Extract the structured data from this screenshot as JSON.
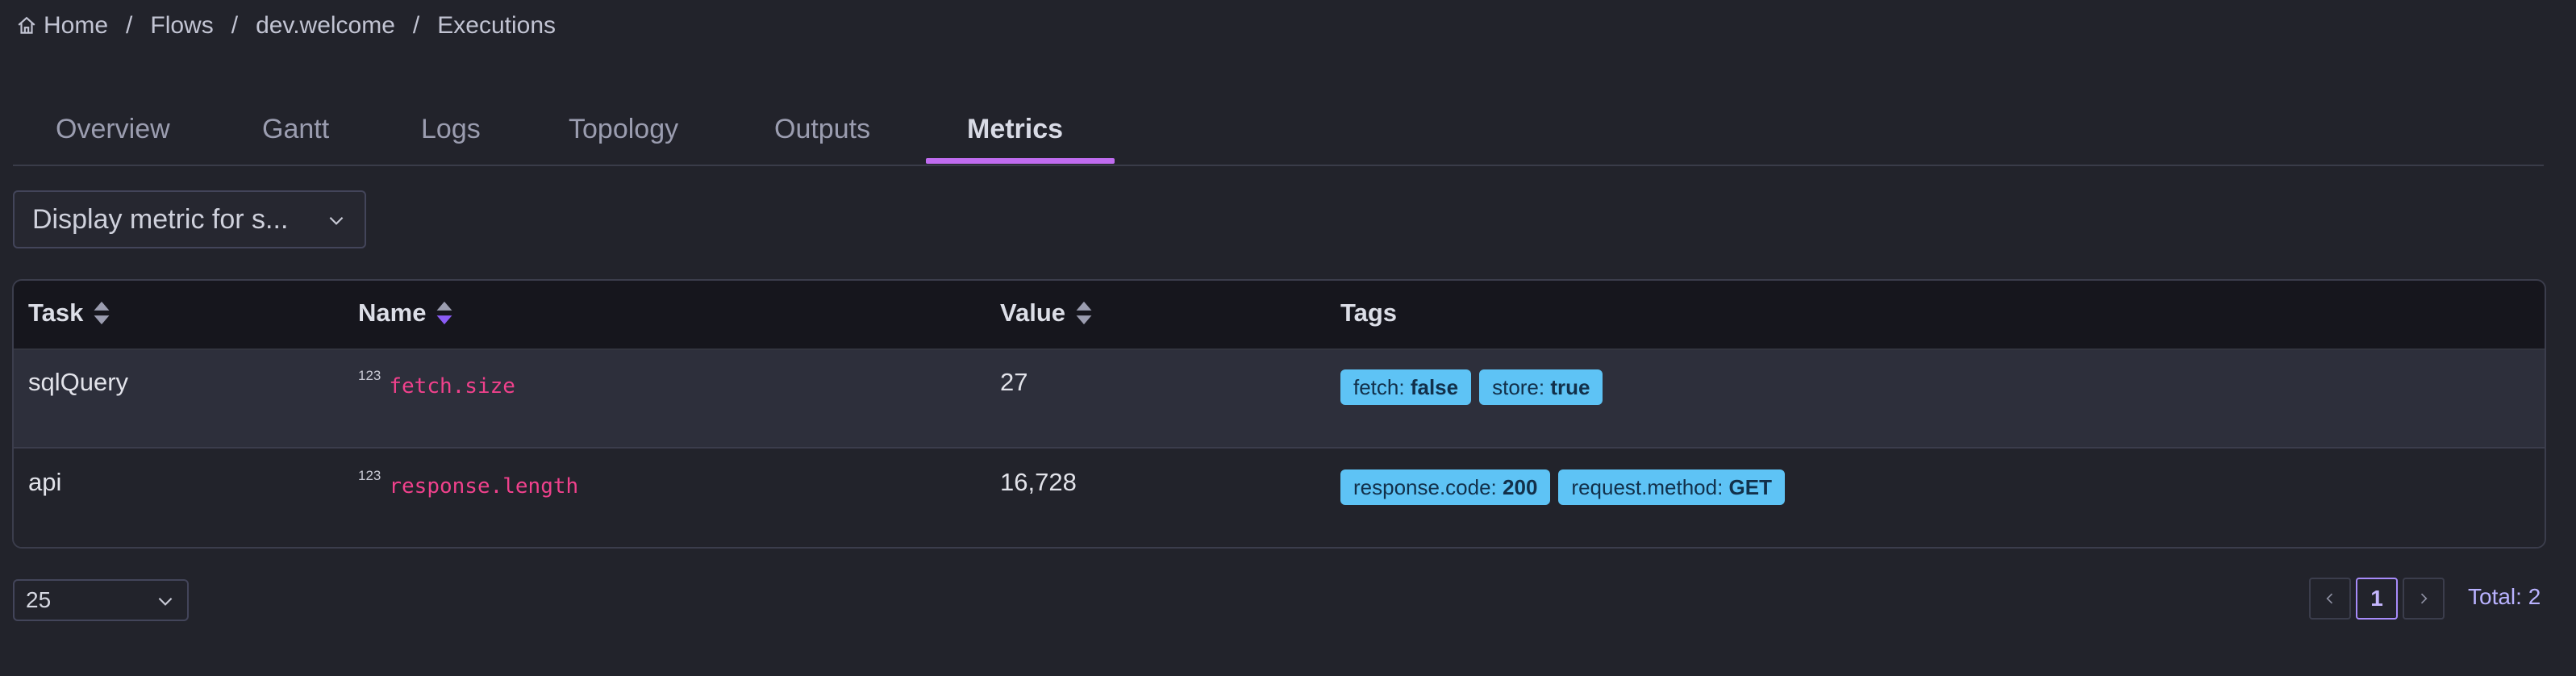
{
  "breadcrumb": {
    "items": [
      "Home",
      "Flows",
      "dev.welcome",
      "Executions"
    ],
    "separator": "/"
  },
  "tabs": [
    {
      "label": "Overview",
      "active": false
    },
    {
      "label": "Gantt",
      "active": false
    },
    {
      "label": "Logs",
      "active": false
    },
    {
      "label": "Topology",
      "active": false
    },
    {
      "label": "Outputs",
      "active": false
    },
    {
      "label": "Metrics",
      "active": true
    }
  ],
  "metric_select": {
    "value": "Display metric for s..."
  },
  "table": {
    "headers": {
      "task": "Task",
      "name": "Name",
      "value": "Value",
      "tags": "Tags"
    },
    "rows": [
      {
        "task": "sqlQuery",
        "type_icon": "123",
        "name": "fetch.size",
        "value": "27",
        "tags": [
          {
            "key": "fetch:",
            "val": "false"
          },
          {
            "key": "store:",
            "val": "true"
          }
        ]
      },
      {
        "task": "api",
        "type_icon": "123",
        "name": "response.length",
        "value": "16,728",
        "tags": [
          {
            "key": "response.code:",
            "val": "200"
          },
          {
            "key": "request.method:",
            "val": "GET"
          }
        ]
      }
    ]
  },
  "footer": {
    "page_size": "25",
    "current_page": "1",
    "total": "Total: 2"
  },
  "colors": {
    "background": "#22232b",
    "accent": "#c06cf0",
    "tag": "#5ec3f5",
    "metric_name": "#f0418c",
    "pager_active": "#a78bfa"
  }
}
